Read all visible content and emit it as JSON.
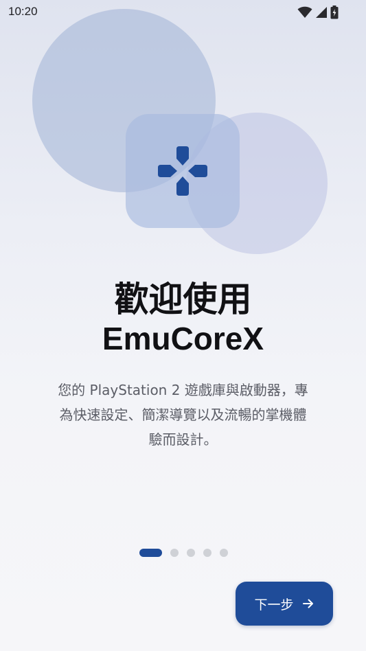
{
  "status_bar": {
    "time": "10:20",
    "icons": [
      "wifi-icon",
      "cellular-signal-icon",
      "battery-charging-icon"
    ]
  },
  "hero": {
    "icon": "gamepad-dpad-icon",
    "accent_color": "#1f4c99"
  },
  "welcome": {
    "title_line1": "歡迎使用",
    "title_line2": "EmuCoreX",
    "description_line1": "您的 PlayStation 2 遊戲庫與啟動器，專",
    "description_line2": "為快速設定、簡潔導覽以及流暢的掌機體",
    "description_line3": "驗而設計。"
  },
  "pager": {
    "total": 5,
    "current": 1
  },
  "next_button": {
    "label": "下一步",
    "icon": "arrow-right-icon"
  }
}
